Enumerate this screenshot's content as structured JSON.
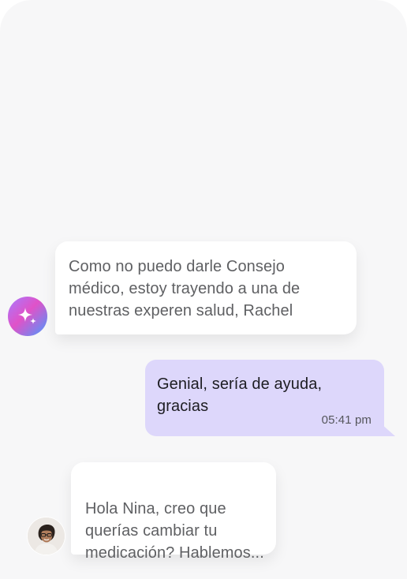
{
  "chat": {
    "messages": [
      {
        "sender": "assistant",
        "text": "Como no puedo darle Consejo médico, estoy trayendo a una de nuestras experen salud, Rachel",
        "avatar_icon": "sparkle-icon"
      },
      {
        "sender": "user",
        "text": "Genial, sería de ayuda, gracias",
        "time": "05:41 pm"
      },
      {
        "sender": "agent",
        "text": "Hola Nina, creo que\nquerías cambiar tu\nmedicación? Hablemos...",
        "avatar_icon": "person-avatar-icon"
      }
    ]
  },
  "colors": {
    "background": "#f7f7f8",
    "incoming_bubble": "#ffffff",
    "outgoing_bubble": "#ddd7fb",
    "incoming_text": "#5f6063",
    "outgoing_text": "#1d1d22"
  }
}
